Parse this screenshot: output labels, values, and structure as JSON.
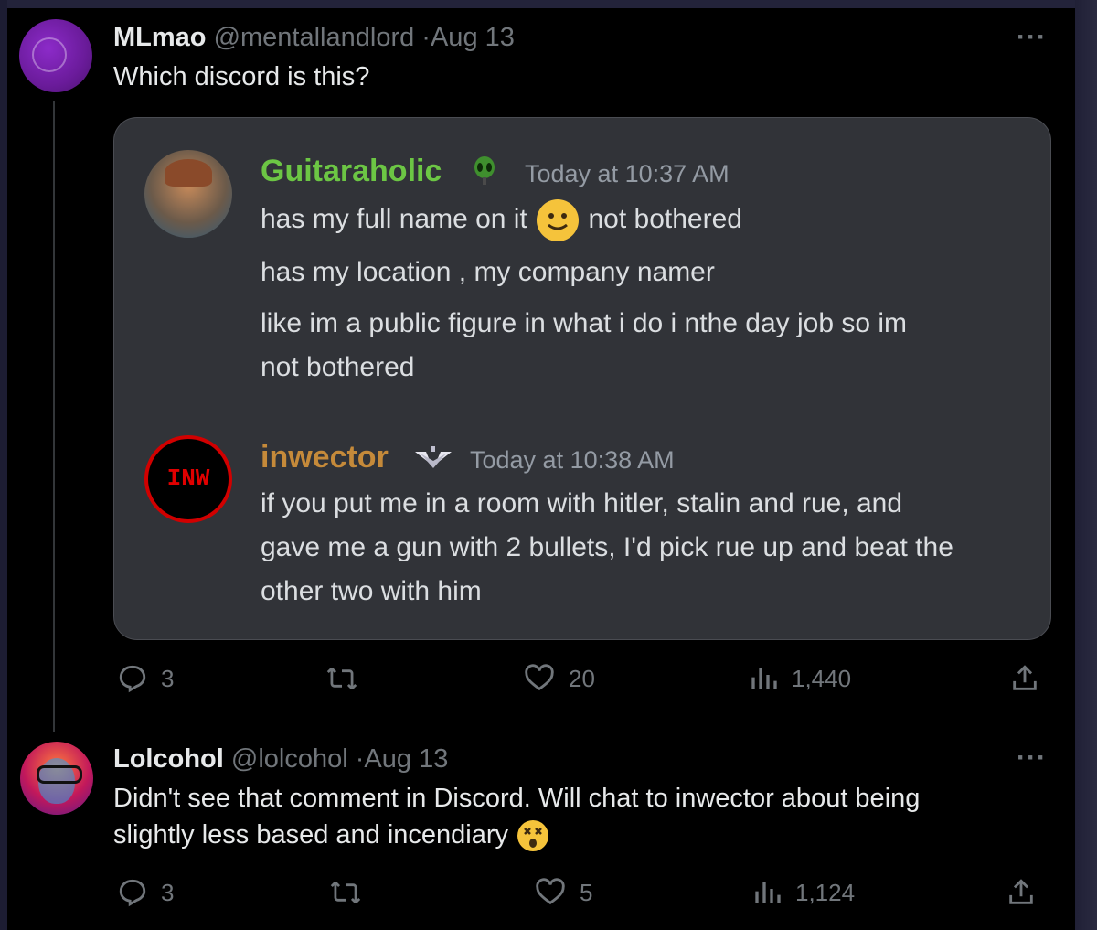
{
  "tweets": [
    {
      "name": "MLmao",
      "handle": "@mentallandlord",
      "sep": "·",
      "date": "Aug 13",
      "text": "Which discord is this?",
      "more": "···",
      "stats": {
        "replies": "3",
        "likes": "20",
        "views": "1,440"
      }
    },
    {
      "name": "Lolcohol",
      "handle": "@lolcohol",
      "sep": "·",
      "date": "Aug 13",
      "text_line1": "Didn't see that comment in Discord. Will chat to inwector about being",
      "text_line2": "slightly less based and incendiary",
      "more": "···",
      "stats": {
        "replies": "3",
        "likes": "5",
        "views": "1,124"
      }
    }
  ],
  "discord": {
    "messages": [
      {
        "author": "Guitaraholic",
        "author_color": "#6cc644",
        "timestamp": "Today at 10:37 AM",
        "lines": {
          "l1a": "has my full name on it",
          "l1b": "not bothered",
          "l2": "has my location , my company namer",
          "l3": "like im a public figure in what i do i nthe day job so im",
          "l4": "not bothered"
        }
      },
      {
        "author": "inwector",
        "author_color": "#c58a3a",
        "avatar_text": "INW",
        "timestamp": "Today at 10:38 AM",
        "lines": {
          "l1": "if you put me in a room with hitler, stalin and rue, and",
          "l2": "gave me a gun with 2 bullets, I'd pick rue up and beat the",
          "l3": "other two with him"
        }
      }
    ]
  },
  "colors": {
    "background": "#000000",
    "text_primary": "#e7e9ea",
    "text_secondary": "#71767b",
    "discord_card": "#313338"
  },
  "icons": [
    "reply-icon",
    "retweet-icon",
    "like-icon",
    "views-icon",
    "share-icon",
    "smile-emoji-icon",
    "dizzy-face-emoji-icon",
    "alien-head-badge-icon",
    "wings-badge-icon"
  ]
}
